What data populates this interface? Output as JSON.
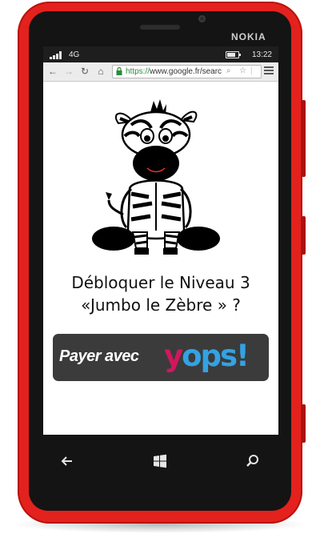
{
  "device": {
    "brand": "NOKIA",
    "shell_color": "#e3211d"
  },
  "status_bar": {
    "network": "4G",
    "time": "13:22",
    "battery_level": 0.8
  },
  "browser": {
    "url_scheme": "https://",
    "url_rest": "www.google.fr/searc",
    "icons": [
      "back-arrow-icon",
      "forward-arrow-icon",
      "reload-icon",
      "home-icon",
      "lock-icon",
      "search-icon",
      "star-icon",
      "menu-icon"
    ]
  },
  "page": {
    "question_line1": "Débloquer le Niveau 3",
    "question_line2": "«Jumbo le Zèbre » ?",
    "pay_button": {
      "label": "Payer avec",
      "brand_y": "y",
      "brand_rest": "ops!",
      "brand_colors": {
        "y": "#d1175e",
        "ops": "#33a2e3"
      },
      "background": "#3b3b3b"
    }
  },
  "nav_bar": {
    "icons": [
      "back-icon",
      "windows-start-icon",
      "search-icon"
    ]
  }
}
